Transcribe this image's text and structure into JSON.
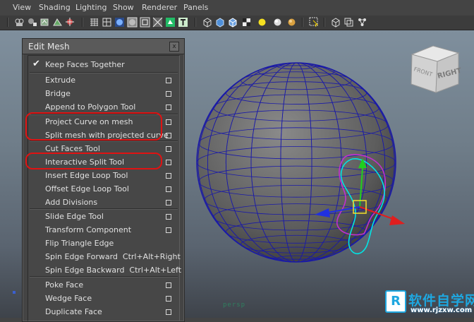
{
  "menubar": [
    "View",
    "Shading",
    "Lighting",
    "Show",
    "Renderer",
    "Panels"
  ],
  "toolbar_icons": [
    "camera-icon",
    "camera-attr-icon",
    "bookmark-icon",
    "image-plane-icon",
    "grid-icon",
    "wireframe-icon",
    "smooth-shade-icon",
    "flat-shade-icon",
    "textured-icon",
    "text-icon",
    "lights-icon",
    "shadows-icon",
    "xray-icon",
    "isolate-icon",
    "resolution-gate-icon",
    "select-camera-icon"
  ],
  "panel": {
    "title": "Edit Mesh",
    "close": "x",
    "items": [
      {
        "label": "Keep Faces Together",
        "checked": true,
        "option": false
      },
      {
        "label": "Extrude",
        "option": true
      },
      {
        "label": "Bridge",
        "option": true
      },
      {
        "label": "Append to Polygon Tool",
        "option": true
      },
      {
        "label": "Project Curve on mesh",
        "option": true
      },
      {
        "label": "Split mesh with projected curve",
        "option": true
      },
      {
        "label": "Cut Faces Tool",
        "option": true
      },
      {
        "label": "Interactive Split Tool",
        "option": true
      },
      {
        "label": "Insert Edge Loop Tool",
        "option": true
      },
      {
        "label": "Offset Edge Loop Tool",
        "option": true
      },
      {
        "label": "Add Divisions",
        "option": true
      },
      {
        "label": "Slide Edge Tool",
        "option": true
      },
      {
        "label": "Transform Component",
        "option": true
      },
      {
        "label": "Flip Triangle Edge",
        "option": false
      },
      {
        "label": "Spin Edge Forward  Ctrl+Alt+Right",
        "option": false
      },
      {
        "label": "Spin Edge Backward  Ctrl+Alt+Left",
        "option": false
      },
      {
        "label": "Poke Face",
        "option": true
      },
      {
        "label": "Wedge Face",
        "option": true
      },
      {
        "label": "Duplicate Face",
        "option": true
      }
    ]
  },
  "viewcube": {
    "front": "FRONT",
    "right": "RIGHT"
  },
  "viewport": {
    "camera_label": "persp"
  },
  "watermark": {
    "logo": "R",
    "text": "软件自学网",
    "url": "www.rjzxw.com"
  },
  "colors": {
    "highlight": "#e01212",
    "wire": "#1a1aa8",
    "curve": "#00e5e5",
    "manip_y": "#1fcf1f",
    "manip_x": "#e01e1e",
    "manip_z": "#2030e0"
  }
}
